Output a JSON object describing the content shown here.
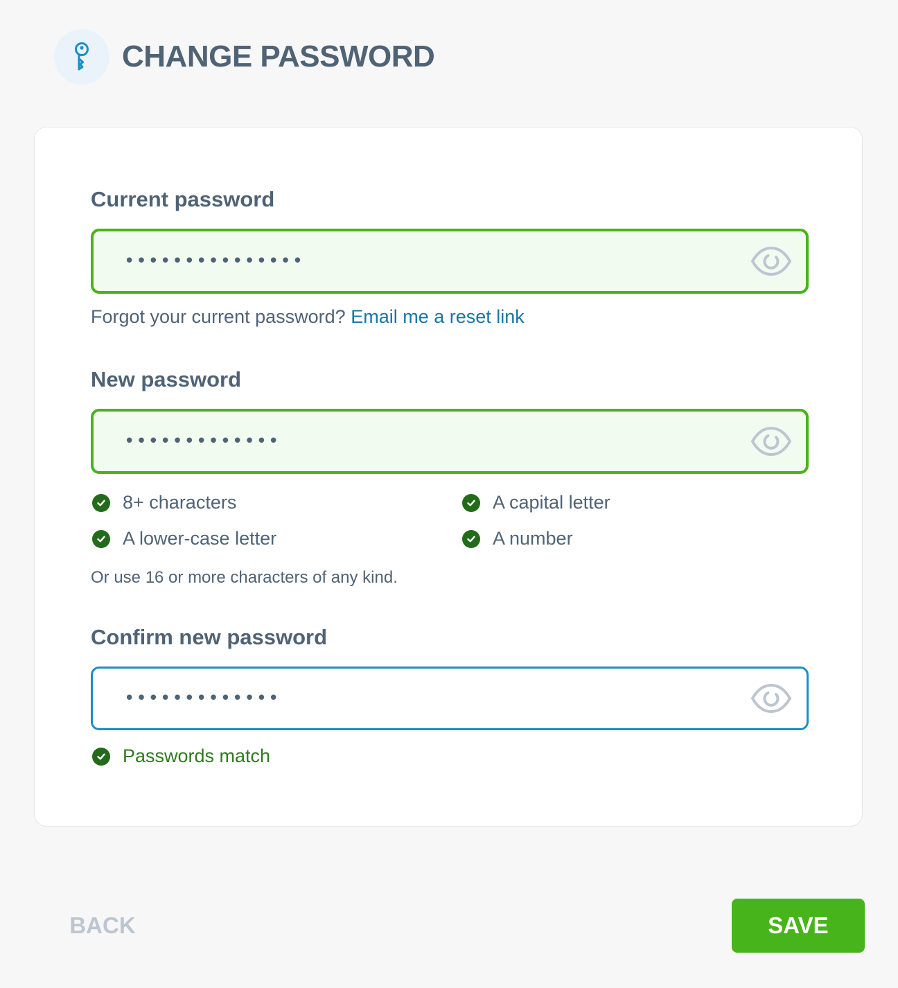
{
  "header": {
    "title": "CHANGE PASSWORD",
    "icon": "key-icon"
  },
  "form": {
    "current_password": {
      "label": "Current password",
      "value": "•••••••••••••••",
      "state": "valid",
      "toggle_icon": "eye-icon"
    },
    "forgot": {
      "text": "Forgot your current password?",
      "link": "Email me a reset link"
    },
    "new_password": {
      "label": "New password",
      "value": "•••••••••••••",
      "state": "valid",
      "toggle_icon": "eye-icon"
    },
    "requirements": [
      {
        "label": "8+ characters",
        "met": true
      },
      {
        "label": "A capital letter",
        "met": true
      },
      {
        "label": "A lower-case letter",
        "met": true
      },
      {
        "label": "A number",
        "met": true
      }
    ],
    "requirements_note": "Or use 16 or more characters of any kind.",
    "confirm_password": {
      "label": "Confirm new password",
      "value": "•••••••••••••",
      "state": "focused",
      "toggle_icon": "eye-icon"
    },
    "match_message": "Passwords match"
  },
  "actions": {
    "back_label": "BACK",
    "save_label": "SAVE"
  },
  "colors": {
    "accent_green": "#48b41b",
    "check_green": "#236b1a",
    "focus_blue": "#1c8ec6",
    "link_blue": "#1a75a3",
    "text": "#4f6375",
    "muted": "#bcc6d1"
  }
}
